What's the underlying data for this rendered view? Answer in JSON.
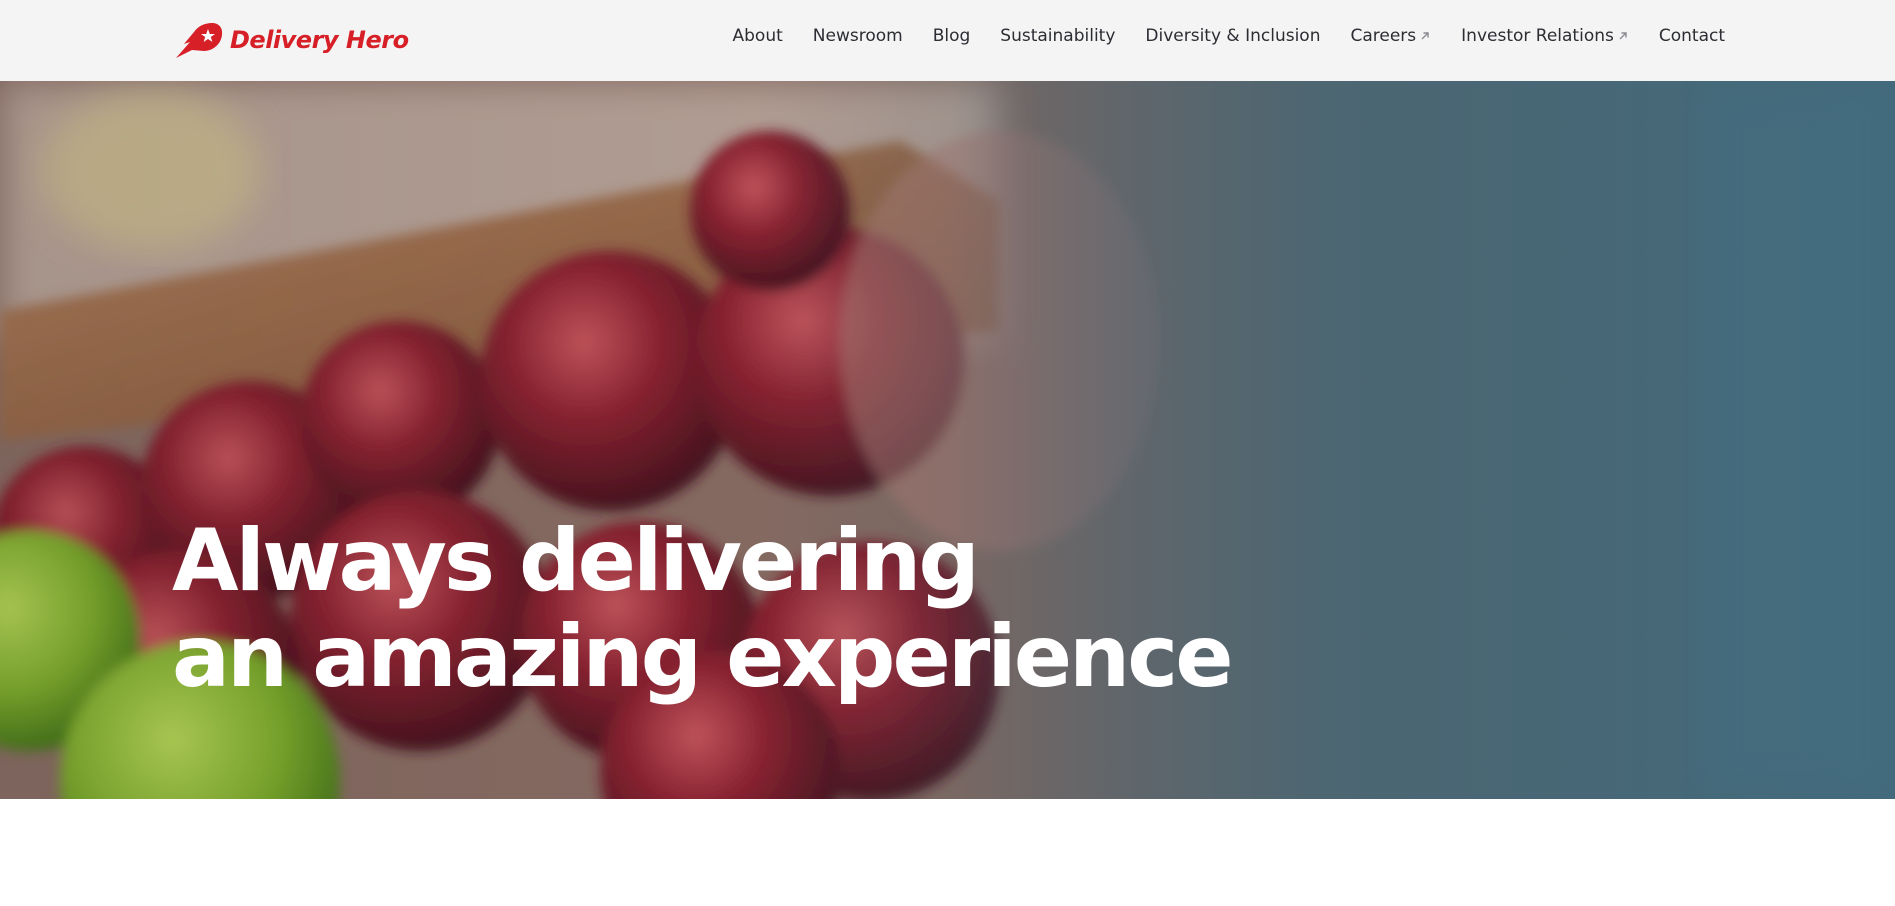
{
  "brand": {
    "name": "Delivery Hero",
    "color": "#d61f26",
    "icon": "delivery-hero-logo-icon"
  },
  "nav": {
    "items": [
      {
        "label": "About",
        "external": false
      },
      {
        "label": "Newsroom",
        "external": false
      },
      {
        "label": "Blog",
        "external": false
      },
      {
        "label": "Sustainability",
        "external": false
      },
      {
        "label": "Diversity & Inclusion",
        "external": false
      },
      {
        "label": "Careers",
        "external": true
      },
      {
        "label": "Investor Relations",
        "external": true
      },
      {
        "label": "Contact",
        "external": false
      }
    ]
  },
  "hero": {
    "line1": "Always delivering",
    "line2": "an amazing experience"
  },
  "colors": {
    "header_bg": "#f4f4f4",
    "nav_text": "#2c2d33",
    "hero_text": "#ffffff"
  }
}
